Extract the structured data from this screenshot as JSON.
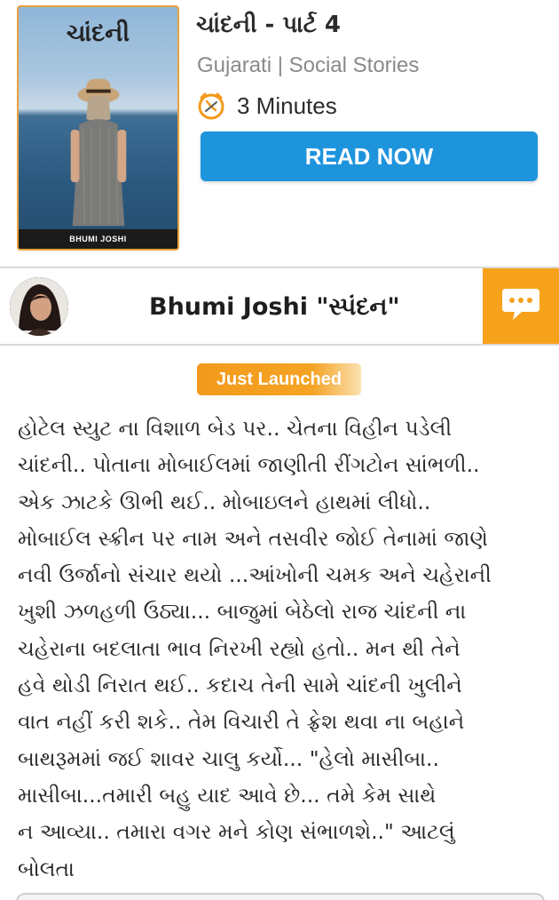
{
  "book": {
    "cover_title": "ચાંદની",
    "cover_author": "BHUMI JOSHI",
    "title": "ચાંદની - પાર્ટ 4",
    "meta": "Gujarati | Social Stories",
    "read_time": "3  Minutes",
    "read_button": "READ NOW",
    "icons": {
      "clock": "clock-icon"
    }
  },
  "author": {
    "name": "Bhumi Joshi \"સ્પંદન\"",
    "icons": {
      "message": "chat-bubble-icon"
    }
  },
  "badge": "Just Launched",
  "story_lines": [
    "હોટેલ સ્યુટ ના વિશાળ  બેડ પર.. ચેતના વિહીન પડેલી",
    "ચાંદની.. પોતાના મોબાઈલમાં જાણીતી રીંગટોન સાંભળી..",
    "એક ઝાટકે ઊભી થઈ..  મોબાઇલને હાથમાં લીધો..",
    "મોબાઈલ સ્ક્રીન પર નામ અને તસવીર જોઈ તેનામાં જાણે",
    "નવી ઉર્જાનો સંચાર થયો ...આંખોની ચમક અને ચહેરાની",
    "ખુશી ઝળહળી ઉઠ્યા... બાજુમાં બેઠેલો રાજ ચાંદની ના",
    "ચહેરાના બદલાતા ભાવ  નિરખી રહ્યો હતો.. મન થી તેને",
    "હવે થોડી નિરાત થઈ.. કદાચ તેની સામે ચાંદની ખુલીને",
    "વાત નહીં કરી શકે.. તેમ વિચારી તે ફ્રેશ થવા ના બહાને",
    "બાથરૂમમાં જઈ શાવર ચાલુ કર્યો... \"હેલો માસીબા..",
    "માસીબા...તમારી બહુ યાદ આવે છે... તમે કેમ સાથે",
    "ન આવ્યા.. તમારા વગર મને કોણ સંભાળશે..\" આટલું",
    "બોલતા"
  ],
  "colors": {
    "accent_blue": "#1e94dd",
    "accent_orange": "#f7a21b",
    "cover_border": "#e8a23a"
  }
}
